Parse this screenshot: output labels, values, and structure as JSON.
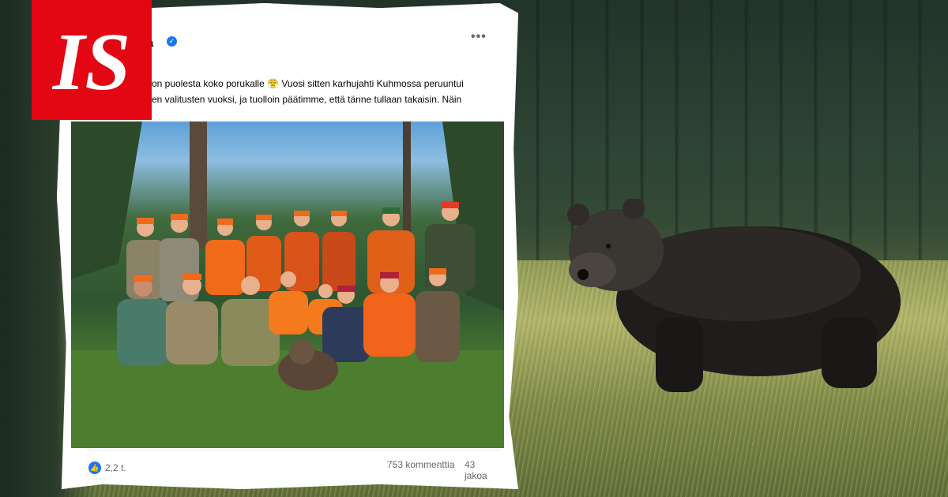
{
  "logo": {
    "text": "IS",
    "color": "#e30613"
  },
  "post": {
    "author_fragment": "ula",
    "more_label": "•••",
    "body_line1": "on puolesta koko porukalle 😤 Vuosi sitten karhujahti Kuhmossa peruuntui",
    "body_line2": "en valitusten vuoksi, ja tuolloin päätimme, että tänne tullaan takaisin. Näin",
    "reactions_count": "2,2 t.",
    "comments_count": "753 kommenttia",
    "shares_count": "43 jakoa",
    "accent_color": "#1877f2"
  }
}
